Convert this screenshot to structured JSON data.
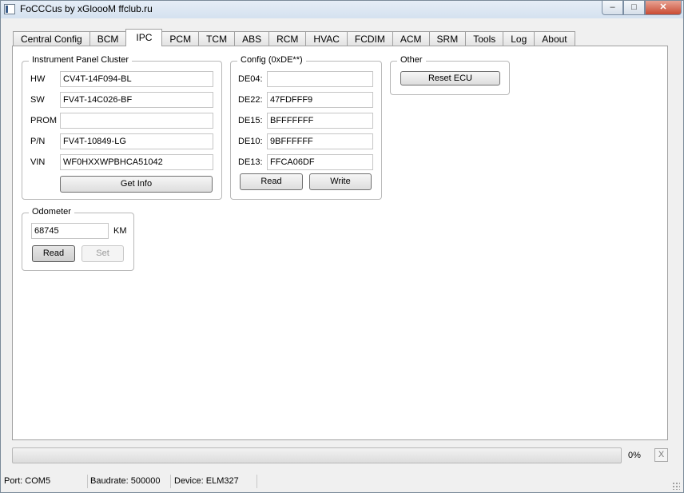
{
  "window": {
    "title": "FoCCCus by xGloooM ffclub.ru"
  },
  "tabs": [
    "Central Config",
    "BCM",
    "IPC",
    "PCM",
    "TCM",
    "ABS",
    "RCM",
    "HVAC",
    "FCDIM",
    "ACM",
    "SRM",
    "Tools",
    "Log",
    "About"
  ],
  "active_tab": "IPC",
  "ipc": {
    "title": "Instrument Panel Cluster",
    "fields": [
      {
        "label": "HW",
        "value": "CV4T-14F094-BL"
      },
      {
        "label": "SW",
        "value": "FV4T-14C026-BF"
      },
      {
        "label": "PROM",
        "value": ""
      },
      {
        "label": "P/N",
        "value": "FV4T-10849-LG"
      },
      {
        "label": "VIN",
        "value": "WF0HXXWPBHCA51042"
      }
    ],
    "get_info_label": "Get Info"
  },
  "config": {
    "title": "Config (0xDE**)",
    "fields": [
      {
        "label": "DE04:",
        "value": ""
      },
      {
        "label": "DE22:",
        "value": "47FDFFF9"
      },
      {
        "label": "DE15:",
        "value": "BFFFFFFF"
      },
      {
        "label": "DE10:",
        "value": "9BFFFFFF"
      },
      {
        "label": "DE13:",
        "value": "FFCA06DF"
      }
    ],
    "read_label": "Read",
    "write_label": "Write"
  },
  "other": {
    "title": "Other",
    "reset_label": "Reset ECU"
  },
  "odometer": {
    "title": "Odometer",
    "value": "68745",
    "unit": "KM",
    "read_label": "Read",
    "set_label": "Set"
  },
  "progress": {
    "percent": 0,
    "text": "0%",
    "cancel_label": "X"
  },
  "status": {
    "port": "Port: COM5",
    "baudrate": "Baudrate: 500000",
    "device": "Device: ELM327"
  },
  "colors": {
    "accent": "#3aa53a",
    "titlebar": "#d4e1ef",
    "close": "#c94b33"
  }
}
